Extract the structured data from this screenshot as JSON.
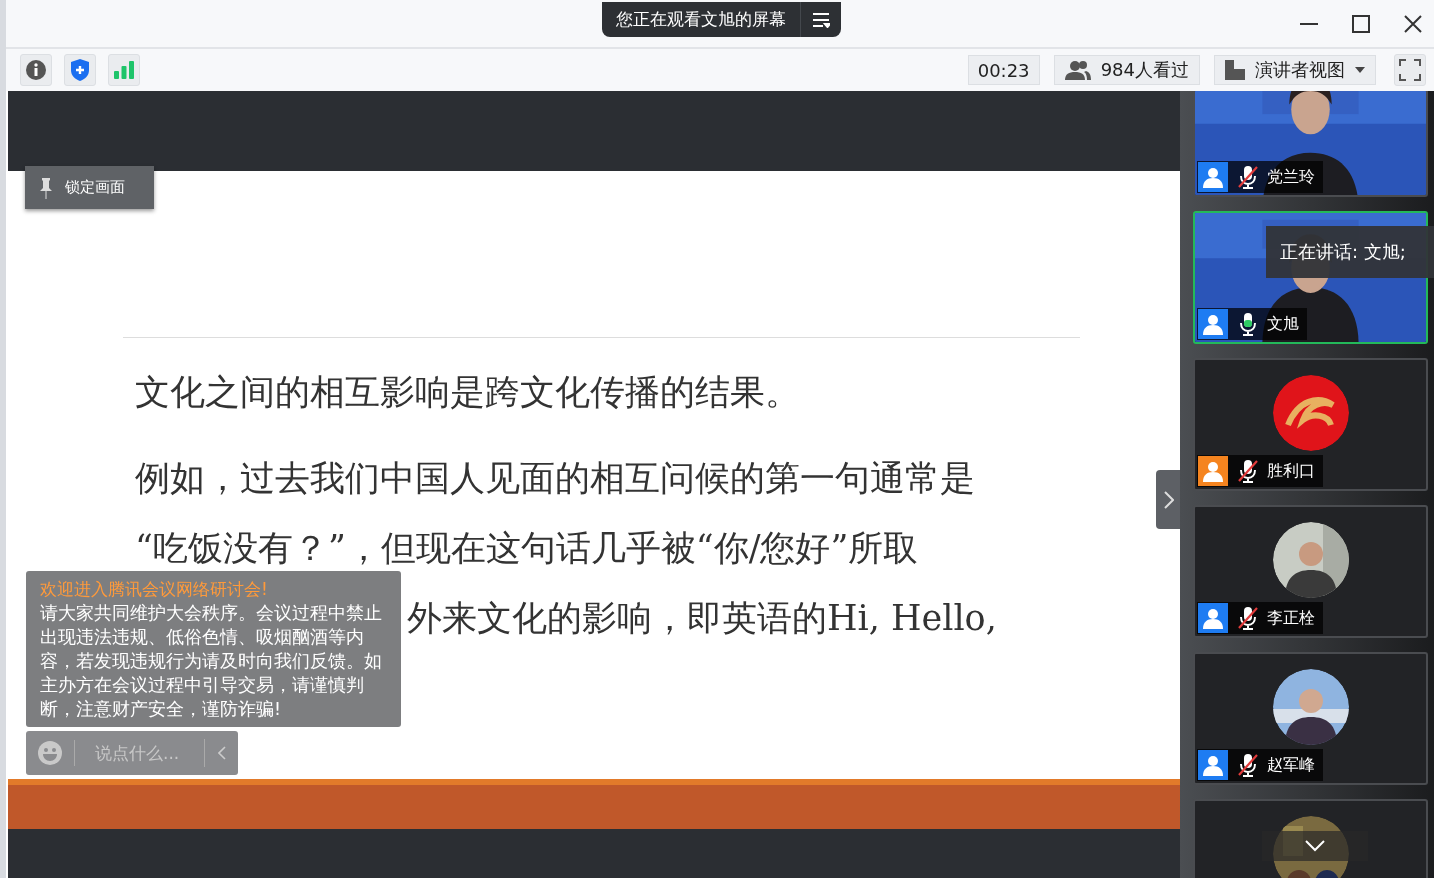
{
  "window": {
    "title": "您正在观看文旭的屏幕"
  },
  "toolbar": {
    "timer": "00:23",
    "viewers": "984人看过",
    "view_mode": "演讲者视图"
  },
  "stage": {
    "lock_button": "锁定画面",
    "slide": {
      "paragraphs": [
        {
          "lines": [
            "文化之间的相互影响是跨文化传播的结果。"
          ]
        },
        {
          "lines": [
            "例如，过去我们中国人见面的相互问候的第一句通常是",
            "“吃饭没有？”，但现在这句话几乎被“你/您好”所取"
          ],
          "uncovered_tail": "外来文化的影响，即英语的Hi, Hello,"
        }
      ]
    },
    "notice": {
      "title": "欢迎进入腾讯会议网络研讨会!",
      "body": "请大家共同维护大会秩序。会议过程中禁止出现违法违规、低俗色情、吸烟酗酒等内容，若发现违规行为请及时向我们反馈。如主办方在会议过程中引导交易，请谨慎判断，注意财产安全，谨防诈骗!"
    },
    "chat_input": {
      "placeholder": "说点什么..."
    }
  },
  "speaking_banner": "正在讲话: 文旭;",
  "participants": [
    {
      "name": "党兰玲",
      "color": "#1e7cf2",
      "muted": true,
      "speaking": false,
      "kind": "video"
    },
    {
      "name": "文旭",
      "color": "#1e7cf2",
      "muted": false,
      "speaking": true,
      "kind": "video"
    },
    {
      "name": "胜利口",
      "color": "#f5841f",
      "muted": true,
      "speaking": false,
      "kind": "avatar"
    },
    {
      "name": "李正栓",
      "color": "#1e7cf2",
      "muted": true,
      "speaking": false,
      "kind": "avatar"
    },
    {
      "name": "赵军峰",
      "color": "#1e7cf2",
      "muted": true,
      "speaking": false,
      "kind": "avatar"
    },
    {
      "kind": "avatar",
      "speaking": false
    }
  ]
}
